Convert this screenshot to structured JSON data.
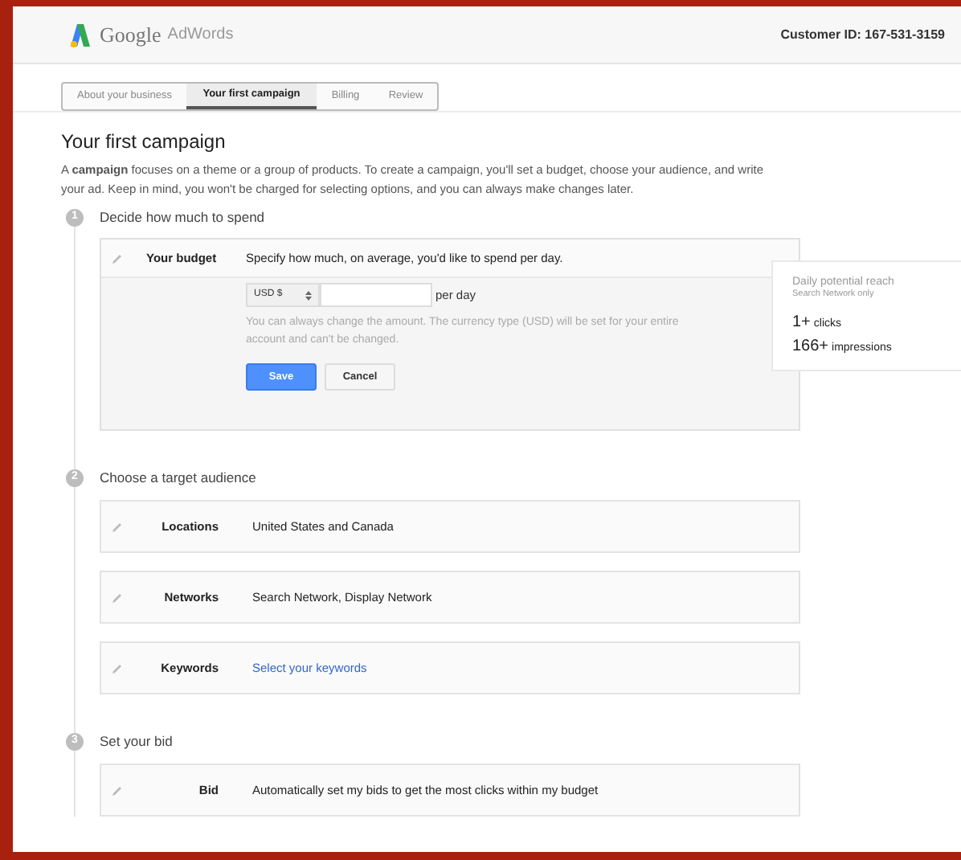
{
  "header": {
    "logo_text": "Google",
    "product": "AdWords",
    "customer_id": "Customer ID: 167-531-3159"
  },
  "tabs": [
    {
      "label": "About your business",
      "selected": false
    },
    {
      "label": "Your first campaign",
      "selected": true
    },
    {
      "label": "Billing",
      "selected": false
    },
    {
      "label": "Review",
      "selected": false
    }
  ],
  "title": "Your first campaign",
  "intro": "A **campaign** focuses on a theme or a group of products. To create a campaign, you'll set a budget, choose your audience, and write your ad. Keep in mind, you won't be charged for selecting options, and you can always make changes later.",
  "steps": [
    {
      "number": "1",
      "title": "Decide how much to spend",
      "budget": {
        "label": "Your budget",
        "prompt": "Specify how much, on average, you'd like to spend per day.",
        "currency": "USD $",
        "unit": "per day",
        "note": "You can always change the amount. The currency type (USD) will be set for your entire account and can't be changed.",
        "buttons": [
          {
            "label": "Save",
            "kind": "primary"
          },
          {
            "label": "Cancel",
            "kind": "secondary"
          }
        ]
      }
    },
    {
      "number": "2",
      "title": "Choose a target audience",
      "rows": [
        {
          "label": "Locations",
          "value": "United States and Canada",
          "kind": "text"
        },
        {
          "label": "Networks",
          "value": "Search Network, Display Network",
          "kind": "text"
        },
        {
          "label": "Keywords",
          "value": "Select your keywords",
          "kind": "link"
        }
      ]
    },
    {
      "number": "3",
      "title": "Set your bid",
      "rows": [
        {
          "label": "Bid",
          "value": "Automatically set my bids to get the most clicks within my budget",
          "kind": "text"
        }
      ]
    }
  ],
  "reach": {
    "title": "Daily potential reach",
    "subtitle": "Search Network only",
    "stats": [
      {
        "value": "1+",
        "label": "clicks"
      },
      {
        "value": "166+",
        "label": "impressions"
      }
    ]
  }
}
